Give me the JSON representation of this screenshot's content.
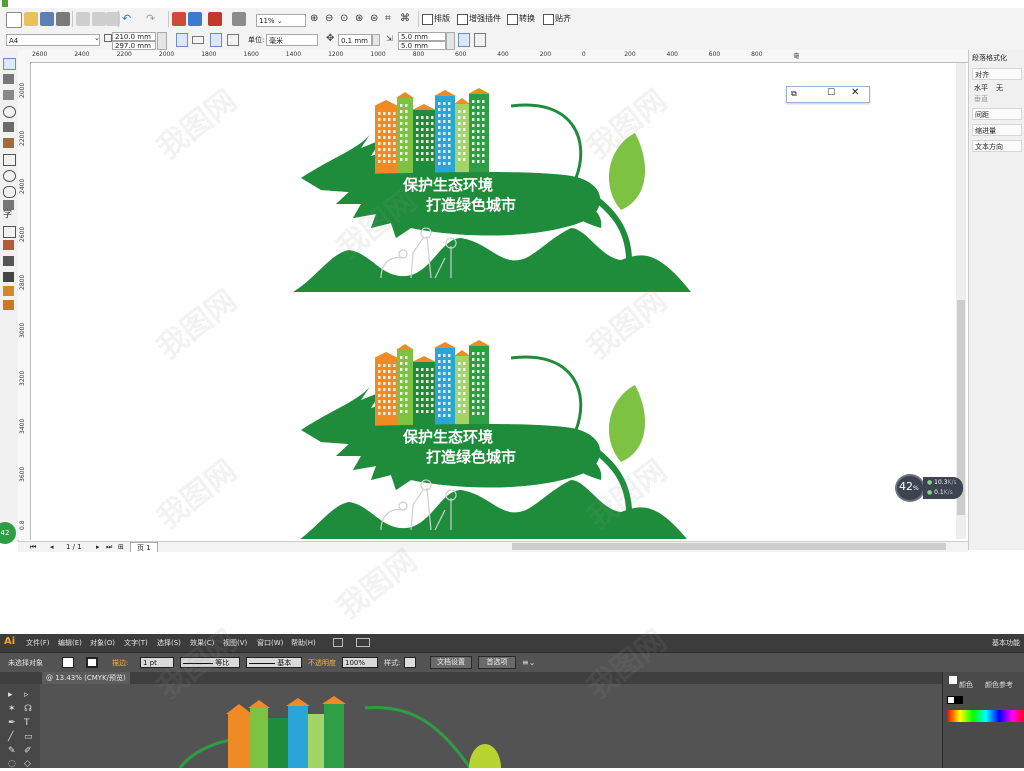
{
  "corel": {
    "toolbar1": {
      "zoom": "11%",
      "buttons": [
        "排版",
        "增强插件",
        "转换",
        "贴齐"
      ]
    },
    "toolbar2": {
      "page_size": "A4",
      "width": "210.0 mm",
      "height": "297.0 mm",
      "unit_label": "单位:",
      "unit": "毫米",
      "nudge": "0.1 mm",
      "dup_x": "5.0 mm",
      "dup_y": "5.0 mm"
    },
    "ruler_h": [
      "2600",
      "2400",
      "2200",
      "2000",
      "1800",
      "1600",
      "1400",
      "1200",
      "1000",
      "800",
      "600",
      "400",
      "200",
      "0",
      "200",
      "400",
      "600",
      "800",
      "毫"
    ],
    "ruler_v": [
      "2000",
      "2200",
      "2400",
      "2600",
      "2800",
      "3000",
      "3200",
      "3400",
      "3600",
      "0.8"
    ],
    "artwork": {
      "line1": "保护生态环境",
      "line2": "打造绿色城市"
    },
    "right_panel": {
      "title": "段落格式化",
      "items": [
        "对齐",
        "水平",
        "无",
        "垂直",
        "间距",
        "缩进量",
        "文本方向"
      ]
    },
    "status": {
      "page_count": "1 / 1",
      "page_tab": "页 1"
    },
    "perf": {
      "percent": "42",
      "percent_unit": "%",
      "up": "10.3",
      "up_unit": "K/s",
      "down": "0.1",
      "down_unit": "K/s"
    },
    "left_badge": "42"
  },
  "illustrator": {
    "logo": "Ai",
    "menus": [
      "文件(F)",
      "编辑(E)",
      "对象(O)",
      "文字(T)",
      "选择(S)",
      "效果(C)",
      "视图(V)",
      "窗口(W)",
      "帮助(H)"
    ],
    "workspace": "基本功能",
    "control": {
      "no_selection": "未选择对象",
      "stroke_label": "描边:",
      "stroke_value": "1 pt",
      "uniform": "等比",
      "basic": "基本",
      "opacity_label": "不透明度",
      "opacity_value": "100%",
      "style_label": "样式:",
      "doc_setup": "文档设置",
      "preferences": "首选项"
    },
    "doc_tab": "@ 13.43% (CMYK/预览)",
    "panel_tabs": [
      "颜色",
      "颜色参考"
    ]
  },
  "watermark_text": "我图网",
  "colors": {
    "green_dark": "#1e8c3a",
    "green_light": "#7dc242",
    "orange": "#f08a24",
    "blue": "#2aa5d8",
    "ai_dark": "#535353"
  }
}
